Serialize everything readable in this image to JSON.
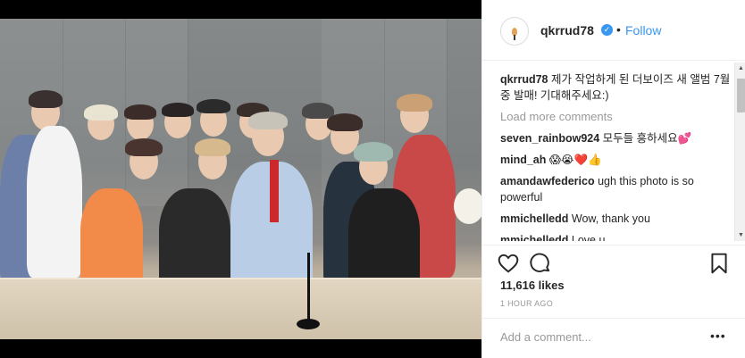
{
  "post": {
    "username": "qkrrud78",
    "follow_label": "Follow",
    "separator": "•",
    "caption_user": "qkrrud78",
    "caption_text": "제가 작업하게 된 더보이즈 새 앨범 7월중 발매! 기대해주세요:)",
    "load_more": "Load more comments",
    "comments": [
      {
        "user": "seven_rainbow924",
        "text": "모두들 흥하세요💕"
      },
      {
        "user": "mind_ah",
        "text": "😱😭❤️👍"
      },
      {
        "user": "amandawfederico",
        "text": "ugh this photo is so powerful"
      },
      {
        "user": "mmichelledd",
        "text": "Wow, thank you"
      },
      {
        "user": "mmichelledd",
        "text": "Love u"
      }
    ],
    "likes": "11,616 likes",
    "time": "1 HOUR AGO",
    "add_comment_placeholder": "Add a comment...",
    "more_options": "•••"
  },
  "colors": {
    "accent": "#3897f0",
    "text": "#262626",
    "muted": "#999999"
  },
  "icons": {
    "like": "heart-icon",
    "comment": "comment-icon",
    "save": "bookmark-icon",
    "verified": "verified-badge-icon"
  }
}
